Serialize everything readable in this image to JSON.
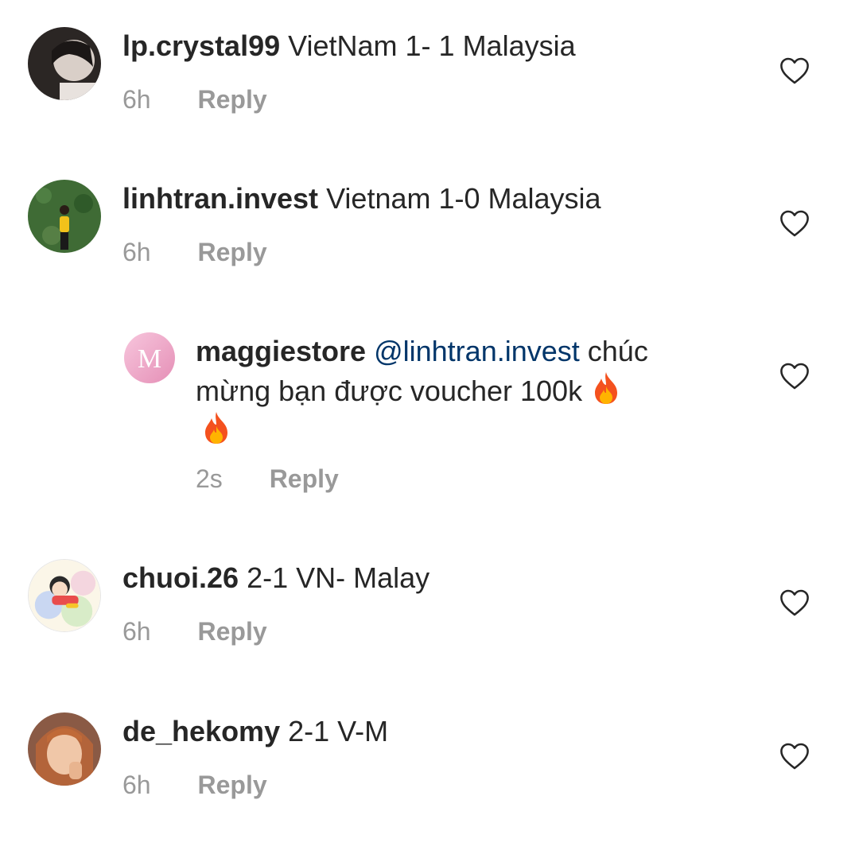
{
  "comments": [
    {
      "username": "lp.crystal99",
      "text": "VietNam 1- 1 Malaysia",
      "time": "6h",
      "reply_label": "Reply",
      "avatar_icon": "user-avatar-photo"
    },
    {
      "username": "linhtran.invest",
      "text": "Vietnam 1-0 Malaysia",
      "time": "6h",
      "reply_label": "Reply",
      "avatar_icon": "user-avatar-photo"
    },
    {
      "username": "maggiestore",
      "mention": "@linhtran.invest",
      "text_line1": "chúc",
      "text_line2": "mừng bạn được voucher 100k",
      "emoji": "fire-emoji",
      "time": "2s",
      "reply_label": "Reply",
      "avatar_icon": "maggiestore-logo",
      "is_reply": true
    },
    {
      "username": "chuoi.26",
      "text": "2-1 VN- Malay",
      "time": "6h",
      "reply_label": "Reply",
      "avatar_icon": "cartoon-avatar"
    },
    {
      "username": "de_hekomy",
      "text": "2-1 V-M",
      "time": "6h",
      "reply_label": "Reply",
      "avatar_icon": "user-avatar-photo"
    }
  ],
  "colors": {
    "username": "#262626",
    "mention": "#003569",
    "meta": "#999999",
    "heart_stroke": "#262626"
  }
}
